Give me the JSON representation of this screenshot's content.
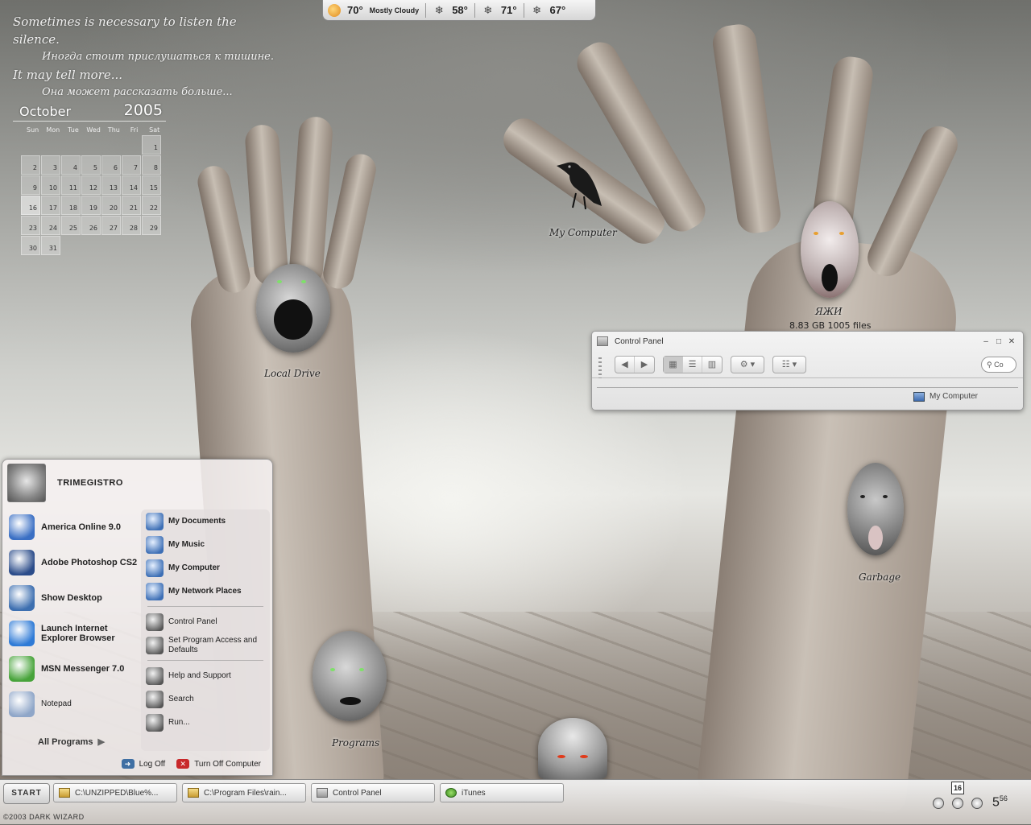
{
  "quote": {
    "line1": "Sometimes is necessary to listen the silence.",
    "line2": "Иногда стоит прислушаться к тишине.",
    "line3": "It may tell more...",
    "line4": "Она может рассказать больше..."
  },
  "calendar": {
    "month": "October",
    "year": "2005",
    "dow": [
      "Sun",
      "Mon",
      "Tue",
      "Wed",
      "Thu",
      "Fri",
      "Sat"
    ],
    "days": [
      "",
      "",
      "",
      "",
      "",
      "",
      "1",
      "2",
      "3",
      "4",
      "5",
      "6",
      "7",
      "8",
      "9",
      "10",
      "11",
      "12",
      "13",
      "14",
      "15",
      "16",
      "17",
      "18",
      "19",
      "20",
      "21",
      "22",
      "23",
      "24",
      "25",
      "26",
      "27",
      "28",
      "29",
      "30",
      "31"
    ],
    "today": "16"
  },
  "weather": {
    "current_temp": "70°",
    "condition": "Mostly Cloudy",
    "forecast": [
      "58°",
      "71°",
      "67°"
    ]
  },
  "desktop_icons": {
    "my_computer": "My Computer",
    "local_drive": "Local Drive",
    "drive_label": "ЯЖИ",
    "drive_info": "8.83 GB 1005 files",
    "garbage": "Garbage",
    "programs": "Programs"
  },
  "control_panel": {
    "title": "Control Panel",
    "search_placeholder": "Co",
    "status": "My Computer"
  },
  "start_menu": {
    "username": "TRIMEGISTRO",
    "pinned": [
      {
        "label": "America Online 9.0",
        "color": "#3a6fc4"
      },
      {
        "label": "Adobe Photoshop CS2",
        "color": "#2b4c8a"
      },
      {
        "label": "Show Desktop",
        "color": "#3d6fb0"
      },
      {
        "label": "Launch Internet Explorer Browser",
        "color": "#2e7ad6"
      },
      {
        "label": "MSN Messenger 7.0",
        "color": "#47a33a"
      },
      {
        "label": "Notepad",
        "color": "#8fa6c8"
      }
    ],
    "all_programs": "All Programs",
    "right": [
      {
        "label": "My Documents",
        "bold": true
      },
      {
        "label": "My Music",
        "bold": true
      },
      {
        "label": "My Computer",
        "bold": true
      },
      {
        "label": "My Network Places",
        "bold": true
      },
      {
        "label": "Control Panel",
        "bold": false
      },
      {
        "label": "Set Program Access and Defaults",
        "bold": false
      },
      {
        "label": "Help and Support",
        "bold": false
      },
      {
        "label": "Search",
        "bold": false
      },
      {
        "label": "Run...",
        "bold": false
      }
    ],
    "log_off": "Log Off",
    "turn_off": "Turn Off Computer"
  },
  "taskbar": {
    "start": "START",
    "tasks": [
      "C:\\UNZIPPED\\Blue%...",
      "C:\\Program Files\\rain...",
      "Control Panel",
      "iTunes"
    ],
    "date": "16",
    "time": "5",
    "time_minutes": "56",
    "footer": "©2003 DARK WIZARD"
  }
}
